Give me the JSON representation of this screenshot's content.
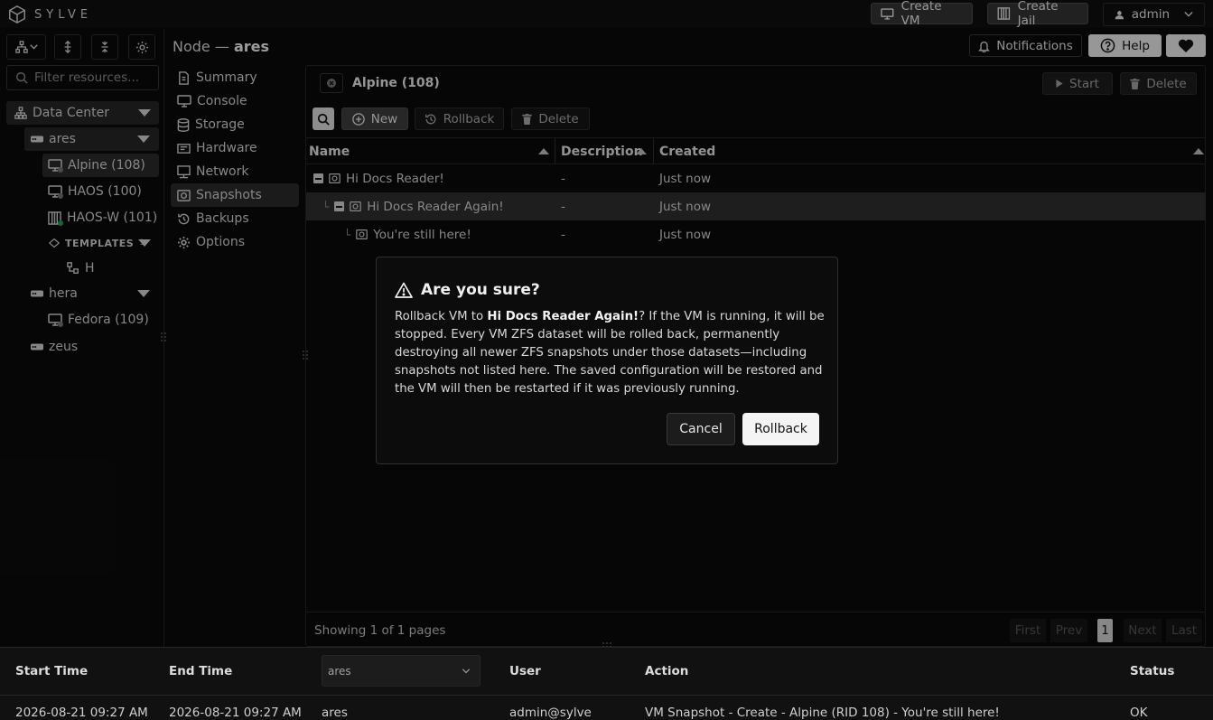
{
  "app": {
    "brand": "SYLVE"
  },
  "topbar": {
    "create_vm": "Create VM",
    "create_jail": "Create Jail",
    "user": "admin"
  },
  "header": {
    "node_prefix": "Node —",
    "node_name": "ares",
    "notifications": "Notifications",
    "help": "Help"
  },
  "sidebar": {
    "filter_placeholder": "Filter resources...",
    "datacenter": "Data Center",
    "nodes": [
      {
        "name": "ares"
      },
      {
        "name": "hera"
      },
      {
        "name": "zeus"
      }
    ],
    "ares_items": [
      "Alpine (108)",
      "HAOS (100)",
      "HAOS-W (101)"
    ],
    "templates_label": "TEMPLATES",
    "templates_count": "1",
    "template_item": "H",
    "hera_items": [
      "Fedora (109)"
    ]
  },
  "menu": [
    "Summary",
    "Console",
    "Storage",
    "Hardware",
    "Network",
    "Snapshots",
    "Backups",
    "Options"
  ],
  "vm": {
    "title": "Alpine (108)",
    "start": "Start",
    "delete": "Delete"
  },
  "toolbar": {
    "new": "New",
    "rollback": "Rollback",
    "delete": "Delete"
  },
  "table": {
    "columns": [
      "Name",
      "Description",
      "Created"
    ],
    "rows": [
      {
        "name": "Hi Docs Reader!",
        "description": "-",
        "created": "Just now"
      },
      {
        "name": "Hi Docs Reader Again!",
        "description": "-",
        "created": "Just now"
      },
      {
        "name": "You're still here!",
        "description": "-",
        "created": "Just now"
      }
    ],
    "footer": "Showing 1 of 1 pages",
    "pagination": {
      "first": "First",
      "prev": "Prev",
      "current": "1",
      "next": "Next",
      "last": "Last"
    }
  },
  "log": {
    "columns": [
      "Start Time",
      "End Time",
      "User",
      "Action",
      "Status"
    ],
    "node_filter": "ares",
    "row": {
      "start": "2026-08-21 09:27 AM",
      "end": "2026-08-21 09:27 AM",
      "node": "ares",
      "user": "admin@sylve",
      "action": "VM Snapshot - Create - Alpine (RID 108) - You're still here!",
      "status": "OK"
    }
  },
  "dialog": {
    "title": "Are you sure?",
    "body_prefix": "Rollback VM to ",
    "body_target": "Hi Docs Reader Again!",
    "body_suffix": "? If the VM is running, it will be stopped. Every VM ZFS dataset will be rolled back, permanently destroying all newer ZFS snapshots under those datasets—including snapshots not listed here. The saved configuration will be restored and the VM will then be restarted if it was previously running.",
    "cancel": "Cancel",
    "confirm": "Rollback"
  },
  "colors": {
    "running_dot": "#16a34a",
    "stopped_dot": "#6b7280",
    "selected_row": "#2e2e2e"
  }
}
